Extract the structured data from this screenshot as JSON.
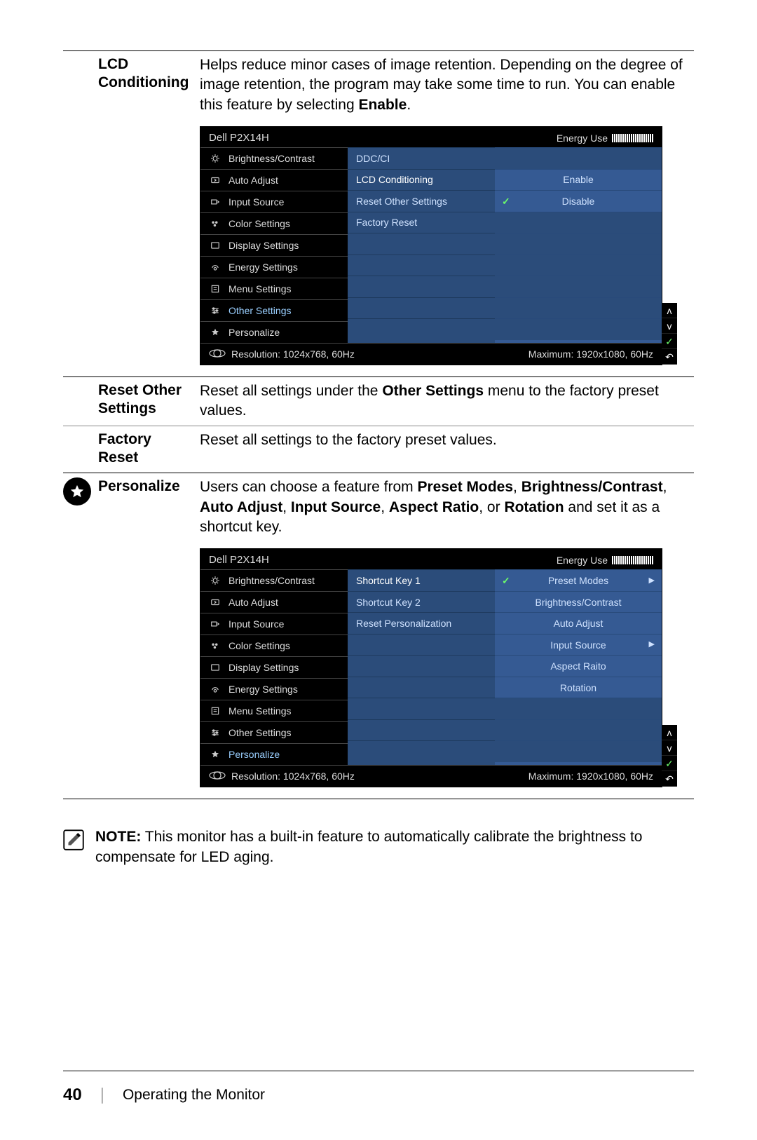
{
  "sections": {
    "lcd": {
      "label": "LCD Conditioning",
      "desc_parts": [
        "Helps reduce minor cases of image retention. Depending on the degree of image retention, the program may take some time to run. You can enable this feature by selecting ",
        "Enable",
        "."
      ]
    },
    "reset_other": {
      "label": "Reset Other Settings",
      "desc_parts": [
        "Reset all settings under the ",
        "Other Settings",
        " menu to the factory preset values."
      ]
    },
    "factory_reset": {
      "label": "Factory Reset",
      "desc": "Reset all settings to the factory preset values."
    },
    "personalize": {
      "label": "Personalize",
      "desc_parts": [
        "Users can choose a feature from ",
        "Preset Modes",
        ", ",
        "Brightness/Contrast",
        ", ",
        "Auto Adjust",
        ", ",
        "Input Source",
        ", ",
        "Aspect Ratio",
        ", or ",
        "Rotation",
        " and set it as a shortcut key."
      ]
    }
  },
  "note_label": "NOTE:",
  "note_text": " This monitor has a built-in feature to automatically calibrate the brightness to compensate for LED aging.",
  "footer": {
    "page": "40",
    "title": "Operating the Monitor"
  },
  "osd_common": {
    "model": "Dell P2X14H",
    "energy_label": "Energy Use",
    "menu": [
      "Brightness/Contrast",
      "Auto Adjust",
      "Input Source",
      "Color Settings",
      "Display Settings",
      "Energy Settings",
      "Menu Settings",
      "Other Settings",
      "Personalize"
    ],
    "resolution": "Resolution: 1024x768, 60Hz",
    "maximum": "Maximum: 1920x1080, 60Hz"
  },
  "osd1": {
    "selected_menu": "Other Settings",
    "mid": [
      "DDC/CI",
      "LCD Conditioning",
      "Reset Other Settings",
      "Factory Reset",
      "",
      "",
      "",
      "",
      ""
    ],
    "mid_selected": 1,
    "opts": [
      {
        "label": "",
        "check": false,
        "arrow": false
      },
      {
        "label": "Enable",
        "check": false,
        "arrow": false
      },
      {
        "label": "Disable",
        "check": true,
        "arrow": false
      },
      {
        "label": "",
        "check": false,
        "arrow": false
      },
      {
        "label": "",
        "check": false,
        "arrow": false
      },
      {
        "label": "",
        "check": false,
        "arrow": false
      },
      {
        "label": "",
        "check": false,
        "arrow": false
      },
      {
        "label": "",
        "check": false,
        "arrow": false
      },
      {
        "label": "",
        "check": false,
        "arrow": false
      }
    ]
  },
  "osd2": {
    "selected_menu": "Personalize",
    "mid": [
      "Shortcut Key 1",
      "Shortcut Key 2",
      "Reset Personalization",
      "",
      "",
      "",
      "",
      "",
      ""
    ],
    "mid_selected": 0,
    "opts": [
      {
        "label": "Preset Modes",
        "check": true,
        "arrow": true
      },
      {
        "label": "Brightness/Contrast",
        "check": false,
        "arrow": false
      },
      {
        "label": "Auto Adjust",
        "check": false,
        "arrow": false
      },
      {
        "label": "Input Source",
        "check": false,
        "arrow": true
      },
      {
        "label": "Aspect Raito",
        "check": false,
        "arrow": false
      },
      {
        "label": "Rotation",
        "check": false,
        "arrow": false
      },
      {
        "label": "",
        "check": false,
        "arrow": false
      },
      {
        "label": "",
        "check": false,
        "arrow": false
      },
      {
        "label": "",
        "check": false,
        "arrow": false
      }
    ]
  }
}
